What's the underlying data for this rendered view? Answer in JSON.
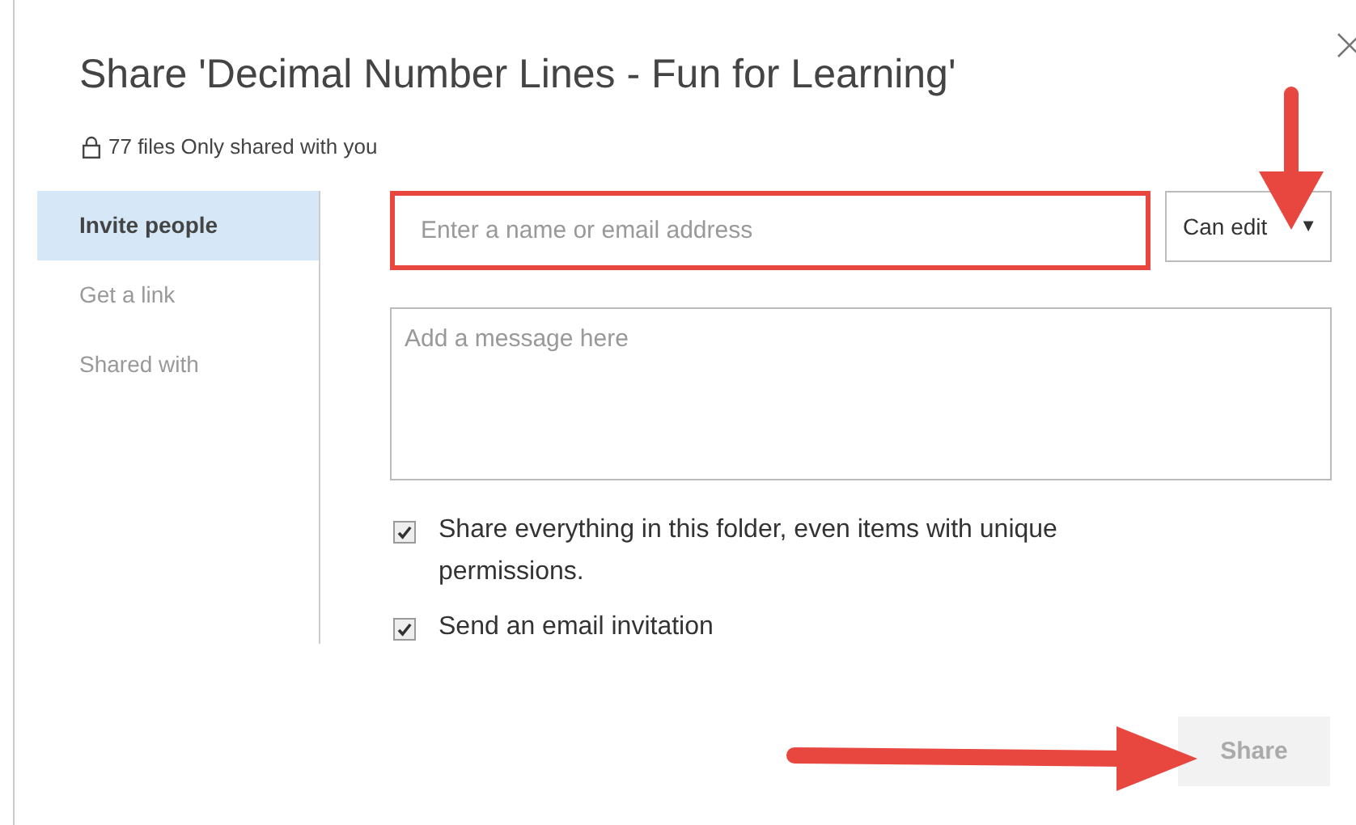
{
  "dialog": {
    "title": "Share 'Decimal Number Lines - Fun for Learning'",
    "sharing_status": "77 files Only shared with you"
  },
  "sidebar": {
    "items": [
      {
        "label": "Invite people",
        "selected": true
      },
      {
        "label": "Get a link",
        "selected": false
      },
      {
        "label": "Shared with",
        "selected": false
      }
    ]
  },
  "recipient_field": {
    "placeholder": "Enter a name or email address",
    "highlighted": true
  },
  "permission_dropdown": {
    "value": "Can edit",
    "caret": "▼"
  },
  "message_field": {
    "placeholder": "Add a message here"
  },
  "options": [
    {
      "label": "Share everything in this folder, even items with unique permissions.",
      "checked": true
    },
    {
      "label": "Send an email invitation",
      "checked": true
    }
  ],
  "share_button": {
    "label": "Share",
    "disabled": true
  }
}
